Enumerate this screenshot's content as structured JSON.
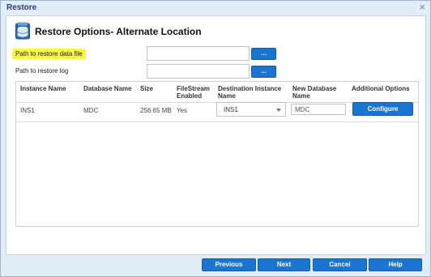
{
  "window": {
    "title": "Restore",
    "close_glyph": "×"
  },
  "header": {
    "icon": "database-icon",
    "heading": "Restore Options- Alternate Location"
  },
  "paths": {
    "data_file_label": "Path to restore data file",
    "data_file_value": "",
    "log_label": "Path to restore log",
    "log_value": "",
    "browse_label": "..."
  },
  "grid": {
    "columns": [
      "Instance Name",
      "Database Name",
      "Size",
      "FileStream\nEnabled",
      "Destination Instance\nName",
      "New Database\nName",
      "Additional Options"
    ],
    "rows": [
      {
        "instance_name": "INS1",
        "database_name": "MDC",
        "size": "256.65 MB",
        "filestream_enabled": "Yes",
        "destination_instance": "INS1",
        "new_database_name": "MDC",
        "action_label": "Configure"
      }
    ]
  },
  "footer": {
    "previous": "Previous",
    "next": "Next",
    "cancel": "Cancel",
    "help": "Help"
  },
  "colors": {
    "accent": "#1b74d0",
    "highlight": "#fbf546",
    "title": "#1c3f72"
  }
}
